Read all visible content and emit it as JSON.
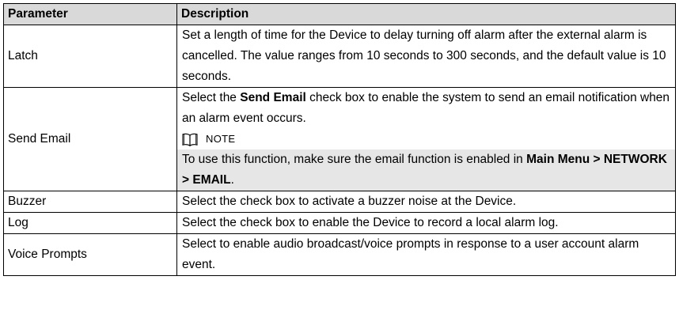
{
  "table": {
    "headers": {
      "parameter": "Parameter",
      "description": "Description"
    },
    "rows": [
      {
        "parameter": "Latch",
        "description": "Set a length of time for the Device to delay turning off alarm after the external alarm is cancelled. The value ranges from 10 seconds to 300 seconds, and the default value is 10 seconds."
      },
      {
        "parameter": "Send Email",
        "description_before_bold": "Select the ",
        "description_bold": "Send Email",
        "description_after_bold": " check box to enable the system to send an email notification when an alarm event occurs.",
        "note_label": "NOTE",
        "note_text": "To use this function, make sure the email function is enabled in ",
        "note_bold": "Main Menu > NETWORK > EMAIL",
        "note_end": ".",
        "note_icon": "book-icon"
      },
      {
        "parameter": "Buzzer",
        "description": "Select the check box to activate a buzzer noise at the Device."
      },
      {
        "parameter": "Log",
        "description": "Select the check box to enable the Device to record a local alarm log."
      },
      {
        "parameter": "Voice Prompts",
        "description": "Select to enable audio broadcast/voice prompts in response to a user account alarm event."
      }
    ]
  },
  "colors": {
    "header_background": "#d9d9d9",
    "note_background": "#e6e6e6",
    "border": "#000000"
  }
}
